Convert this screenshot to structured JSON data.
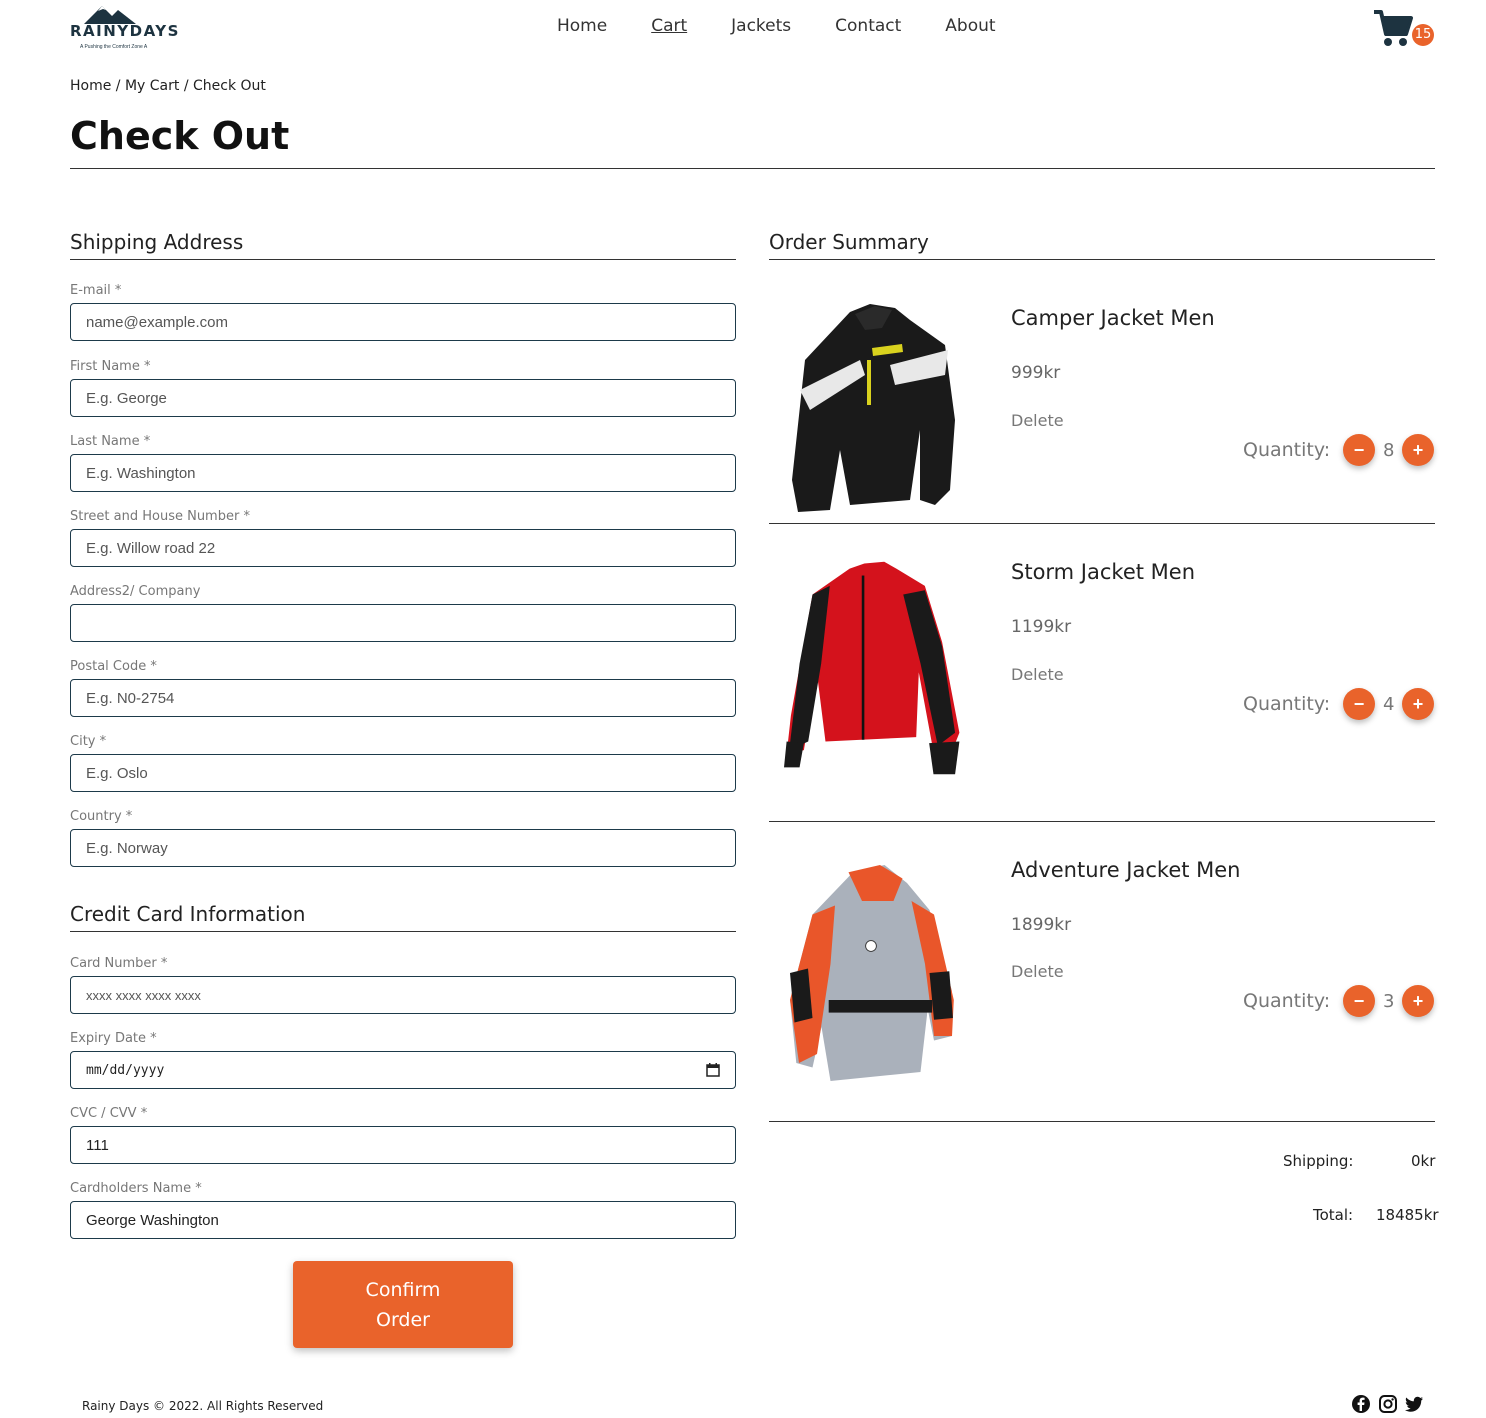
{
  "brand": {
    "name": "RAINYDAYS",
    "tagline": "A Pushing the Comfort Zone A"
  },
  "nav": {
    "items": [
      "Home",
      "Cart",
      "Jackets",
      "Contact",
      "About"
    ]
  },
  "cart": {
    "count": "15"
  },
  "breadcrumb": "Home / My Cart / Check Out",
  "page_title": "Check Out",
  "shipping": {
    "heading": "Shipping Address",
    "fields": [
      {
        "label": "E-mail *",
        "placeholder": "name@example.com"
      },
      {
        "label": "First Name *",
        "placeholder": "E.g. George"
      },
      {
        "label": "Last Name *",
        "placeholder": "E.g. Washington"
      },
      {
        "label": "Street and House Number *",
        "placeholder": "E.g. Willow road 22"
      },
      {
        "label": "Address2/ Company",
        "placeholder": ""
      },
      {
        "label": "Postal Code *",
        "placeholder": "E.g. N0-2754"
      },
      {
        "label": "City *",
        "placeholder": "E.g. Oslo"
      },
      {
        "label": "Country *",
        "placeholder": "E.g. Norway"
      }
    ]
  },
  "card": {
    "heading": "Credit Card Information",
    "number_label": "Card Number *",
    "number_placeholder": "xxxx xxxx xxxx xxxx",
    "expiry_label": "Expiry Date *",
    "expiry_value": "mm/dd/yyyy",
    "cvc_label": "CVC / CVV *",
    "cvc_value": "111",
    "name_label": "Cardholders Name *",
    "name_value": "George Washington"
  },
  "confirm": {
    "line1": "Confirm",
    "line2": "Order"
  },
  "order": {
    "heading": "Order Summary",
    "quantity_label": "Quantity:",
    "delete_label": "Delete",
    "items": [
      {
        "name": "Camper Jacket Men",
        "price": "999kr",
        "quantity": "8"
      },
      {
        "name": "Storm Jacket Men",
        "price": "1199kr",
        "quantity": "4"
      },
      {
        "name": "Adventure Jacket Men",
        "price": "1899kr",
        "quantity": "3"
      }
    ],
    "shipping_label": "Shipping:",
    "shipping_value": "0kr",
    "total_label": "Total:",
    "total_value": "18485kr"
  },
  "footer": {
    "copyright": "Rainy Days © 2022. All Rights Reserved"
  },
  "icons": [
    "mountain-logo-icon",
    "cart-icon",
    "calendar-icon",
    "facebook-icon",
    "instagram-icon",
    "twitter-icon"
  ],
  "colors": {
    "accent": "#e9632b",
    "border": "#1d3a4a",
    "dark": "#1d3340"
  }
}
